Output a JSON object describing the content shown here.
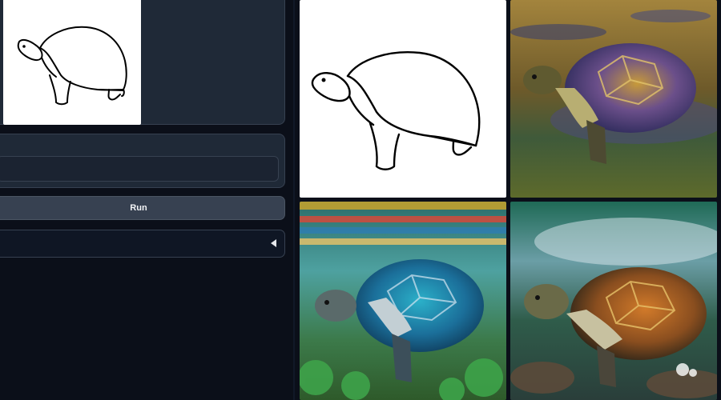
{
  "controls": {
    "run_label": "Run",
    "prompt_value": "",
    "prompt_placeholder": ""
  },
  "gallery": {
    "tiles": [
      {
        "kind": "sketch",
        "icon": "turtle-sketch-icon"
      },
      {
        "kind": "photo",
        "theme": "turtle in shallow water"
      },
      {
        "kind": "photo",
        "theme": "turtle underwater with coral"
      },
      {
        "kind": "photo",
        "theme": "turtle on rocks"
      }
    ]
  },
  "colors": {
    "page_bg": "#0b0f19",
    "panel_bg": "#1f2937",
    "button_bg": "#374151",
    "border": "#374151"
  }
}
